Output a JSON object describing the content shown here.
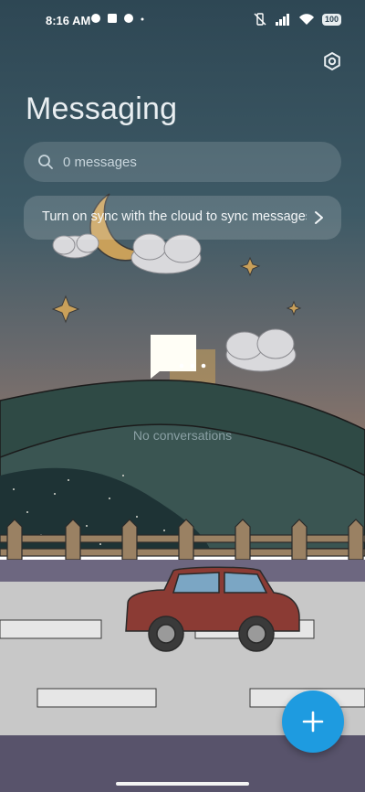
{
  "status_bar": {
    "time": "8:16 AM",
    "battery": "100"
  },
  "header": {
    "title": "Messaging"
  },
  "search": {
    "placeholder": "0 messages"
  },
  "sync_banner": {
    "text": "Turn on sync with the cloud to sync messages"
  },
  "empty_state": {
    "text": "No conversations"
  },
  "icons": {
    "settings": "gear-icon",
    "search": "search-icon",
    "chevron": "chevron-right-icon",
    "fab": "plus-icon"
  },
  "colors": {
    "fab": "#1e9be0",
    "sky_top": "#2f4753",
    "sky_bottom": "#8e7568"
  }
}
